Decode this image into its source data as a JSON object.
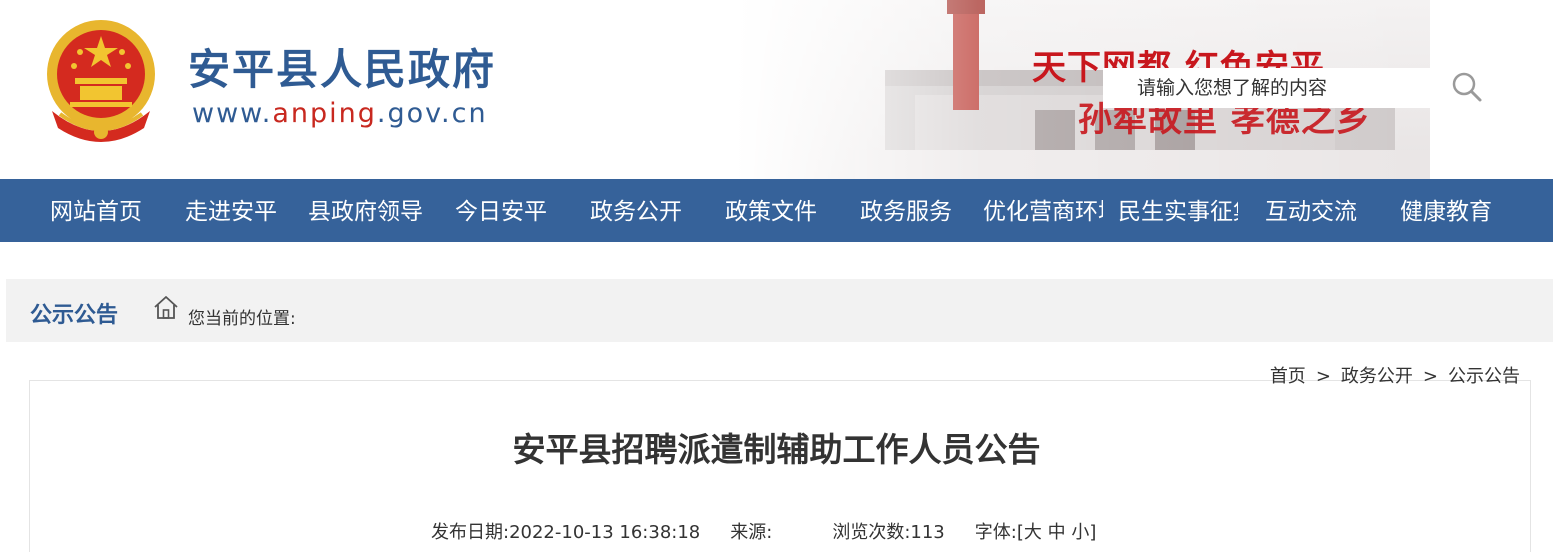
{
  "header": {
    "site_title": "安平县人民政府",
    "site_url_prefix": "www.",
    "site_url_accent": "anping",
    "site_url_suffix": ".gov.cn",
    "slogan_line1": "天下网都  红色安平",
    "slogan_line2": "孙犁故里  孝德之乡"
  },
  "search": {
    "placeholder": "请输入您想了解的内容"
  },
  "nav": {
    "items": [
      "网站首页",
      "走进安平",
      "县政府领导",
      "今日安平",
      "政务公开",
      "政策文件",
      "政务服务",
      "优化营商环境",
      "民生实事征集",
      "互动交流",
      "健康教育"
    ]
  },
  "location": {
    "section_title": "公示公告",
    "label": "您当前的位置:"
  },
  "breadcrumb": {
    "items": [
      "首页",
      "政务公开",
      "公示公告"
    ],
    "separator": ">"
  },
  "article": {
    "title": "安平县招聘派遣制辅助工作人员公告",
    "publish_label": "发布日期:",
    "publish_date": "2022-10-13  16:38:18",
    "source_label": "来源:",
    "source_value": "",
    "views_label": "浏览次数:",
    "views_value": "113",
    "font_label": "字体:",
    "font_open": "[",
    "font_large": "大",
    "font_medium": "中",
    "font_small": "小",
    "font_close": "]"
  },
  "colors": {
    "nav_bg": "#36629a",
    "brand_blue": "#2f5b93",
    "slogan_red": "#c8171d"
  },
  "icons": {
    "emblem": "national-emblem-icon",
    "search": "search-icon",
    "home": "home-icon"
  }
}
